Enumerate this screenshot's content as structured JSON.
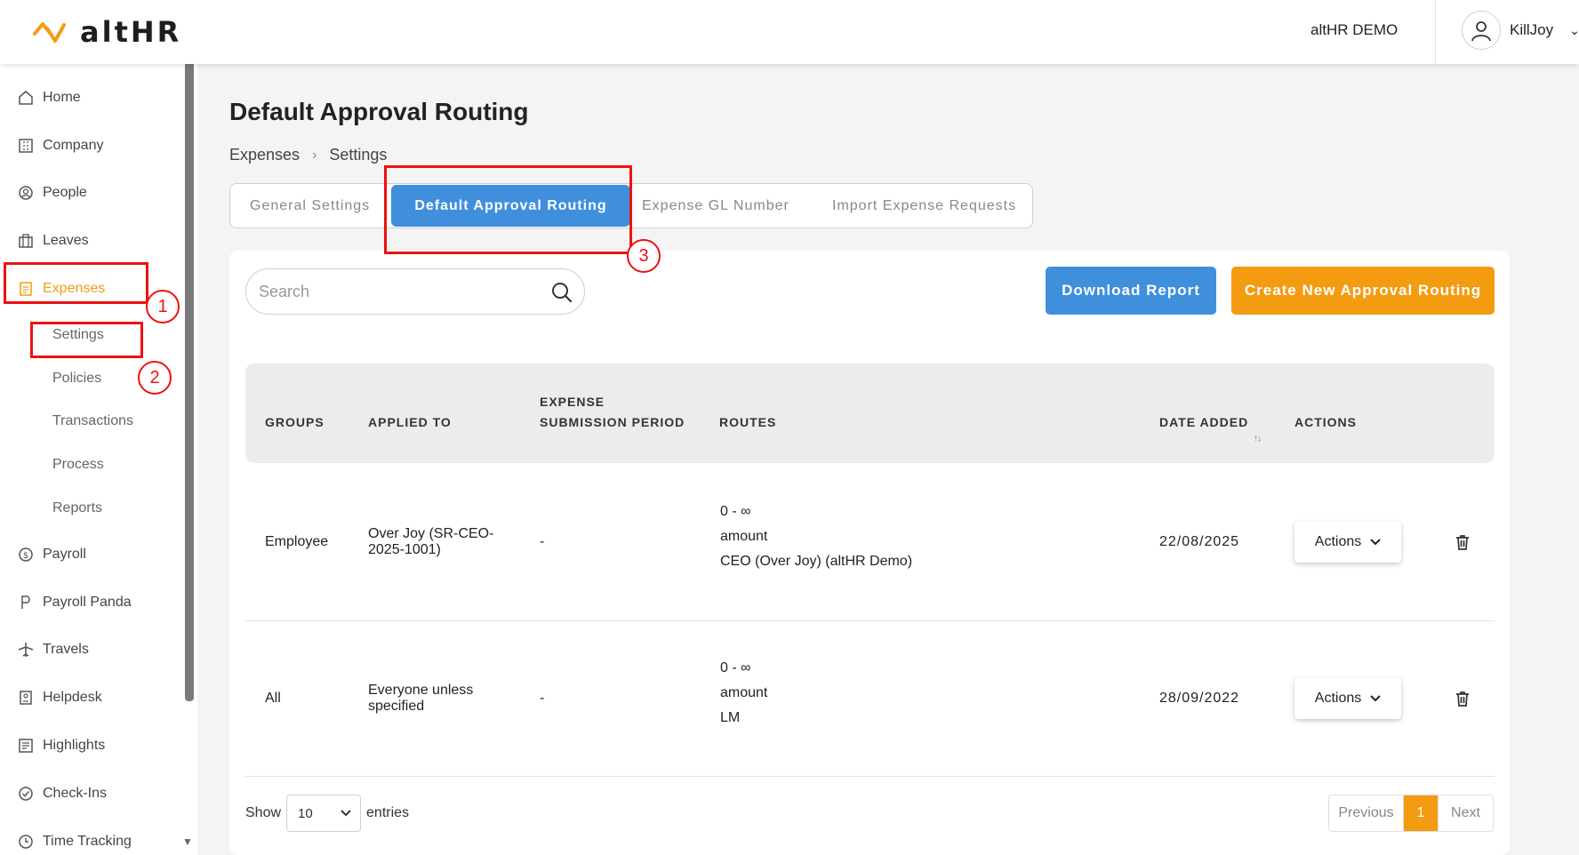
{
  "header": {
    "logo_text": "altHR",
    "org_name": "altHR DEMO",
    "user_name": "KillJoy"
  },
  "sidebar": {
    "items": [
      {
        "label": "Home",
        "icon": "home-icon"
      },
      {
        "label": "Company",
        "icon": "building-icon"
      },
      {
        "label": "People",
        "icon": "people-icon"
      },
      {
        "label": "Leaves",
        "icon": "leaves-icon"
      },
      {
        "label": "Expenses",
        "icon": "expenses-icon",
        "active": true
      },
      {
        "label": "Payroll",
        "icon": "payroll-icon"
      },
      {
        "label": "Payroll Panda",
        "icon": "panda-icon"
      },
      {
        "label": "Travels",
        "icon": "plane-icon"
      },
      {
        "label": "Helpdesk",
        "icon": "helpdesk-icon"
      },
      {
        "label": "Highlights",
        "icon": "highlights-icon"
      },
      {
        "label": "Check-Ins",
        "icon": "check-icon"
      },
      {
        "label": "Time Tracking",
        "icon": "clock-icon"
      }
    ],
    "subitems": [
      "Settings",
      "Policies",
      "Transactions",
      "Process",
      "Reports"
    ]
  },
  "page": {
    "title": "Default Approval Routing",
    "breadcrumb": [
      "Expenses",
      "Settings"
    ]
  },
  "tabs": [
    "General Settings",
    "Default Approval Routing",
    "Expense GL Number",
    "Import Expense Requests"
  ],
  "search": {
    "placeholder": "Search"
  },
  "buttons": {
    "download": "Download Report",
    "create": "Create New Approval Routing"
  },
  "table": {
    "headers": {
      "groups": "GROUPS",
      "applied_to": "APPLIED TO",
      "period_1": "EXPENSE",
      "period_2": "SUBMISSION PERIOD",
      "routes": "ROUTES",
      "date": "DATE ADDED",
      "actions": "ACTIONS",
      "sort": "↑↓"
    },
    "rows": [
      {
        "group": "Employee",
        "applied_1": "Over Joy (SR-CEO-",
        "applied_2": "2025-1001)",
        "period": "-",
        "route_range": "0 - ∞",
        "route_type": "amount",
        "route_approver": "CEO (Over Joy) (altHR Demo)",
        "date": "22/08/2025",
        "action_label": "Actions"
      },
      {
        "group": "All",
        "applied_1": "Everyone unless",
        "applied_2": "specified",
        "period": "-",
        "route_range": "0 - ∞",
        "route_type": "amount",
        "route_approver": "LM",
        "date": "28/09/2022",
        "action_label": "Actions"
      }
    ]
  },
  "footer": {
    "show_label": "Show",
    "page_size": "10",
    "entries_label": "entries",
    "prev": "Previous",
    "current": "1",
    "next": "Next"
  },
  "annotations": [
    "1",
    "2",
    "3"
  ],
  "colors": {
    "accent_orange": "#f39c12",
    "accent_blue": "#3f8fdd",
    "annotation_red": "#ee1111"
  }
}
